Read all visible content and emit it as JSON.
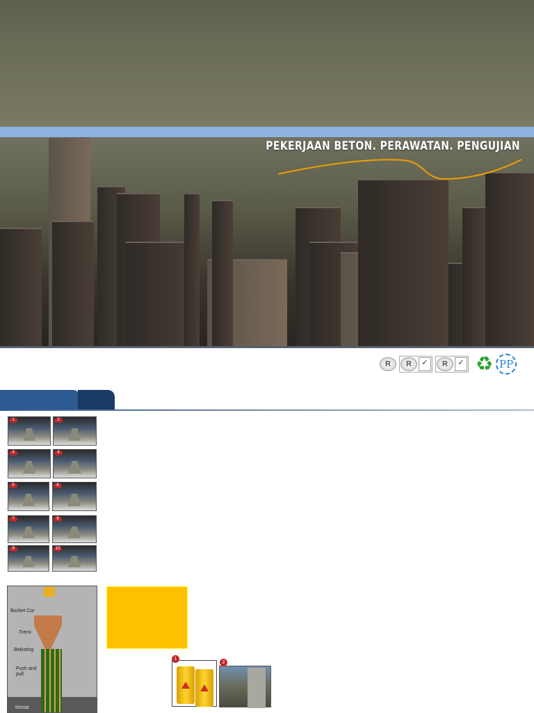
{
  "header": {
    "title": "PEKERJAAN BETON. PERAWATAN. PENGUJIAN",
    "accent": "#8db3e2",
    "curve_color": "#f0a000"
  },
  "logos": {
    "registered": "R",
    "pp": "PP"
  },
  "slump_steps": [
    "1",
    "2",
    "4",
    "4",
    "5",
    "6",
    "7",
    "8",
    "9",
    "10"
  ],
  "diagram": {
    "labels": [
      "Bucket Cor",
      "Tremi",
      "Bekisting",
      "Push and pull",
      "Mortar"
    ]
  },
  "photos": {
    "badges": [
      "1",
      "2"
    ]
  },
  "colors": {
    "tab": "#2e5a93",
    "tab_dark": "#1a3a66",
    "highlight": "#ffc000"
  }
}
